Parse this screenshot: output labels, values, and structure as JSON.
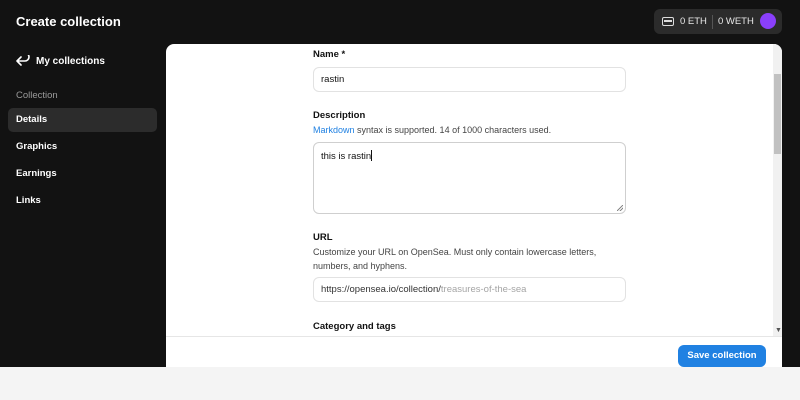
{
  "header": {
    "title": "Create collection",
    "eth_balance": "0 ETH",
    "weth_balance": "0 WETH"
  },
  "sidebar": {
    "back_label": "My collections",
    "section_label": "Collection",
    "items": [
      {
        "label": "Details",
        "active": true
      },
      {
        "label": "Graphics",
        "active": false
      },
      {
        "label": "Earnings",
        "active": false
      },
      {
        "label": "Links",
        "active": false
      }
    ]
  },
  "form": {
    "name": {
      "label": "Name *",
      "value": "rastin"
    },
    "description": {
      "label": "Description",
      "helper_link": "Markdown",
      "helper_text": " syntax is supported. 14 of 1000 characters used.",
      "value": "this is rastin"
    },
    "url": {
      "label": "URL",
      "helper": "Customize your URL on OpenSea. Must only contain lowercase letters, numbers, and hyphens.",
      "prefix": "https://opensea.io/collection/",
      "placeholder": "treasures-of-the-sea"
    },
    "category": {
      "label": "Category and tags"
    }
  },
  "footer": {
    "save_label": "Save collection"
  },
  "colors": {
    "accent": "#2081e2",
    "avatar": "#8a3ffc",
    "sidebar_bg": "#121212"
  },
  "icons": [
    "wallet-icon",
    "back-arrow-icon",
    "avatar"
  ]
}
